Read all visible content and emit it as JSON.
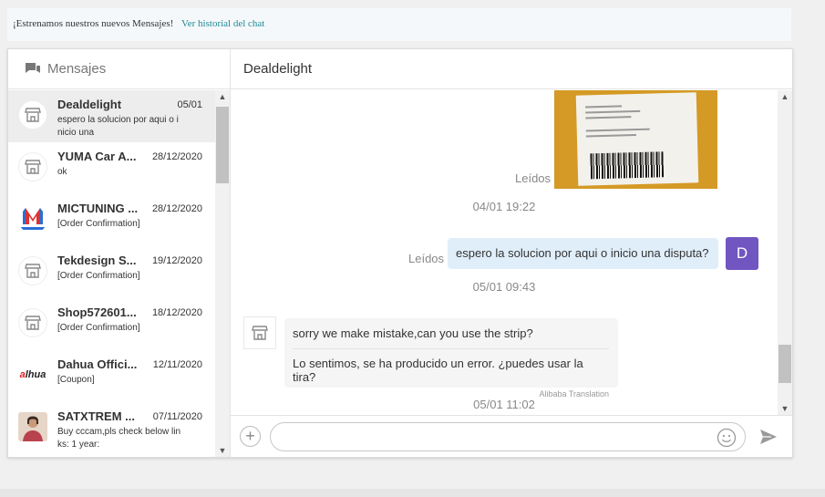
{
  "notice": {
    "text": "¡Estrenamos nuestros nuevos Mensajes!",
    "link": "Ver historial del chat"
  },
  "sidebar": {
    "title": "Mensajes",
    "conversations": [
      {
        "name": "Dealdelight",
        "date": "05/01",
        "preview": "espero la solucion por aqui o i nicio una",
        "avatar": "store-icon"
      },
      {
        "name": "YUMA Car A...",
        "date": "28/12/2020",
        "preview": "ok",
        "avatar": "store-icon"
      },
      {
        "name": "MICTUNING ...",
        "date": "28/12/2020",
        "preview": "[Order Confirmation]",
        "avatar": "mictuning-logo"
      },
      {
        "name": "Tekdesign S...",
        "date": "19/12/2020",
        "preview": "[Order Confirmation]",
        "avatar": "store-icon"
      },
      {
        "name": "Shop572601...",
        "date": "18/12/2020",
        "preview": "[Order Confirmation]",
        "avatar": "store-icon"
      },
      {
        "name": "Dahua Offici...",
        "date": "12/11/2020",
        "preview": "[Coupon]",
        "avatar": "dahua-logo",
        "logo_text": "alhua"
      },
      {
        "name": "SATXTREM ...",
        "date": "07/11/2020",
        "preview": "Buy cccam,pls check below lin ks: 1 year:",
        "avatar": "person-photo"
      }
    ]
  },
  "chat": {
    "title": "Dealdelight",
    "image_read_label": "Leídos",
    "image_time": "04/01 19:22",
    "outgoing": {
      "text": "espero la solucion por aqui o inicio una disputa?",
      "read_label": "Leídos",
      "avatar_letter": "D"
    },
    "outgoing_time": "05/01 09:43",
    "incoming": {
      "original": "sorry we make mistake,can you use the strip?",
      "translation": "Lo sentimos, se ha producido un error. ¿puedes usar la tira?",
      "translation_note": "Alibaba Translation"
    },
    "incoming_time": "05/01 11:02",
    "input_placeholder": ""
  },
  "colors": {
    "accent_link": "#1f8a95",
    "outgoing_bubble": "#e0eefa",
    "user_avatar": "#7155c1",
    "active_conversation": "#ededed"
  }
}
